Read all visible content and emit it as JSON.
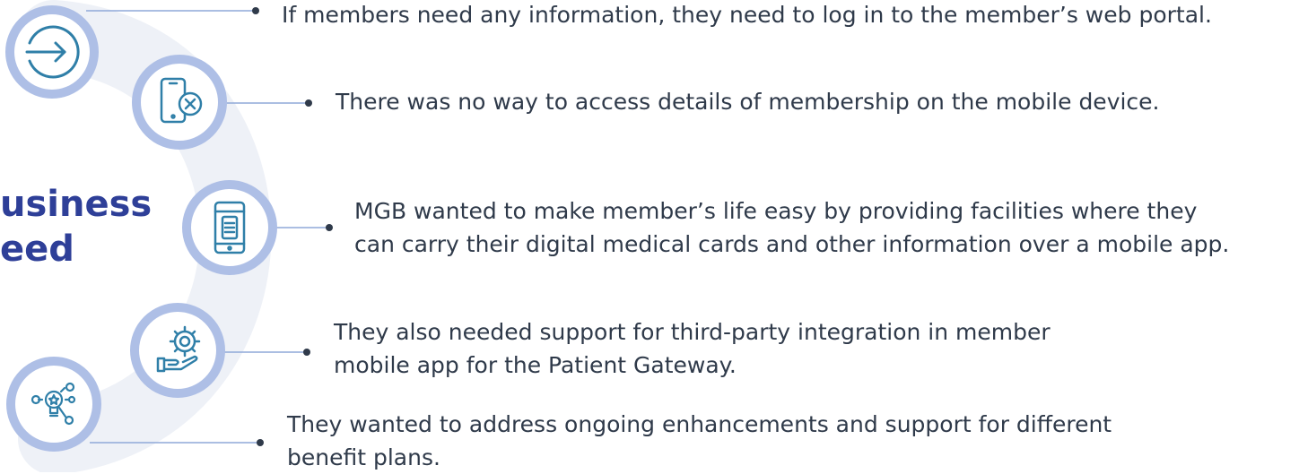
{
  "heading": {
    "line1": "usiness",
    "line2": "eed"
  },
  "colors": {
    "ring": "#aebfe6",
    "icon": "#2f7fa8",
    "connector": "#8fa9d9",
    "arc": "#eef1f7",
    "heading": "#2e3f98",
    "text": "#2f3a4a"
  },
  "items": [
    {
      "icon": "login-arrow-icon",
      "line1": "If members need any information, they need to log in to the member’s web portal.",
      "line2": ""
    },
    {
      "icon": "phone-cancel-icon",
      "line1": "There was no way to access details of membership on the mobile device.",
      "line2": ""
    },
    {
      "icon": "phone-document-icon",
      "line1": "MGB wanted to make member’s life easy by providing facilities where they",
      "line2": "can carry their digital medical cards and other information over a mobile app."
    },
    {
      "icon": "gear-hand-icon",
      "line1": "They also needed support for third-party integration in member",
      "line2": "mobile app for the Patient Gateway."
    },
    {
      "icon": "lightbulb-ideas-icon",
      "line1": "They wanted to address ongoing enhancements and support for different",
      "line2": "benefit plans."
    }
  ]
}
